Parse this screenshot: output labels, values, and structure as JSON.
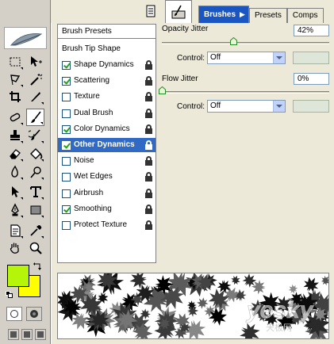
{
  "tabs": [
    {
      "label": "Brushes",
      "active": true
    },
    {
      "label": "Presets",
      "active": false
    },
    {
      "label": "Comps",
      "active": false
    }
  ],
  "brush_settings": {
    "headers": [
      "Brush Presets",
      "Brush Tip Shape"
    ],
    "items": [
      {
        "label": "Shape Dynamics",
        "checked": true,
        "selected": false
      },
      {
        "label": "Scattering",
        "checked": true,
        "selected": false
      },
      {
        "label": "Texture",
        "checked": false,
        "selected": false
      },
      {
        "label": "Dual Brush",
        "checked": false,
        "selected": false
      },
      {
        "label": "Color Dynamics",
        "checked": true,
        "selected": false
      },
      {
        "label": "Other Dynamics",
        "checked": true,
        "selected": true
      },
      {
        "label": "Noise",
        "checked": false,
        "selected": false
      },
      {
        "label": "Wet Edges",
        "checked": false,
        "selected": false
      },
      {
        "label": "Airbrush",
        "checked": false,
        "selected": false
      },
      {
        "label": "Smoothing",
        "checked": true,
        "selected": false
      },
      {
        "label": "Protect Texture",
        "checked": false,
        "selected": false
      }
    ]
  },
  "opacity_jitter": {
    "label": "Opacity Jitter",
    "value": "42%",
    "level": 0.42,
    "control_label": "Control:",
    "control_value": "Off"
  },
  "flow_jitter": {
    "label": "Flow Jitter",
    "value": "0%",
    "level": 0,
    "control_label": "Control:",
    "control_value": "Off"
  },
  "colors": {
    "foreground": "#b4f50a",
    "background": "#ffff00",
    "selection": "#316ac5",
    "tab_active": "#1a56c2"
  },
  "icons": {
    "tools": [
      "marquee-icon",
      "move-icon",
      "lasso-icon",
      "magic-wand-icon",
      "crop-icon",
      "slice-icon",
      "healing-brush-icon",
      "brush-icon",
      "clone-stamp-icon",
      "history-brush-icon",
      "eraser-icon",
      "paint-bucket-icon",
      "blur-icon",
      "dodge-icon",
      "path-selection-icon",
      "type-icon",
      "pen-icon",
      "rectangle-shape-icon",
      "notes-icon",
      "eyedropper-icon",
      "hand-icon",
      "zoom-icon"
    ]
  },
  "preview": {
    "watermark_main": "yesky",
    "watermark_sub": "天极网"
  }
}
